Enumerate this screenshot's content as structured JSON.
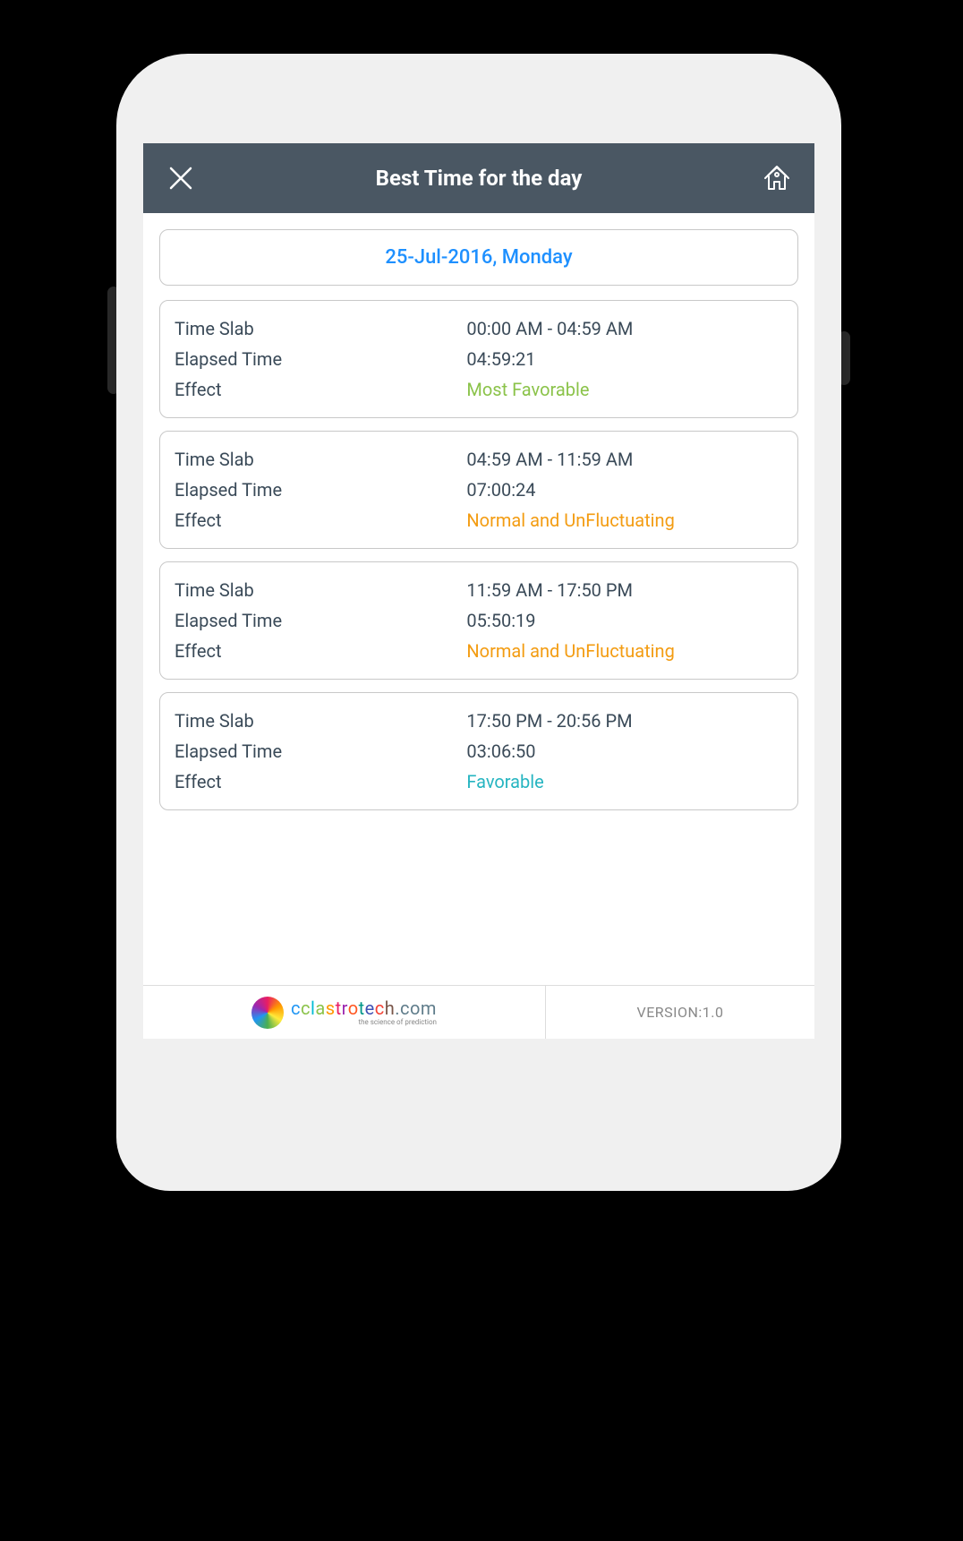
{
  "header": {
    "title": "Best Time for the day"
  },
  "date_display": "25-Jul-2016, Monday",
  "labels": {
    "time_slab": "Time Slab",
    "elapsed_time": "Elapsed Time",
    "effect": "Effect"
  },
  "slabs": [
    {
      "time_slab": "00:00 AM - 04:59 AM",
      "elapsed_time": "04:59:21",
      "effect": "Most Favorable",
      "effect_class": "effect-most-favorable"
    },
    {
      "time_slab": "04:59 AM - 11:59 AM",
      "elapsed_time": "07:00:24",
      "effect": "Normal and UnFluctuating",
      "effect_class": "effect-normal"
    },
    {
      "time_slab": "11:59 AM - 17:50 PM",
      "elapsed_time": "05:50:19",
      "effect": "Normal and UnFluctuating",
      "effect_class": "effect-normal"
    },
    {
      "time_slab": "17:50 PM - 20:56 PM",
      "elapsed_time": "03:06:50",
      "effect": "Favorable",
      "effect_class": "effect-favorable"
    }
  ],
  "footer": {
    "brand": "cclastrotech.com",
    "tagline": "the science of prediction",
    "version": "VERSION:1.0"
  }
}
